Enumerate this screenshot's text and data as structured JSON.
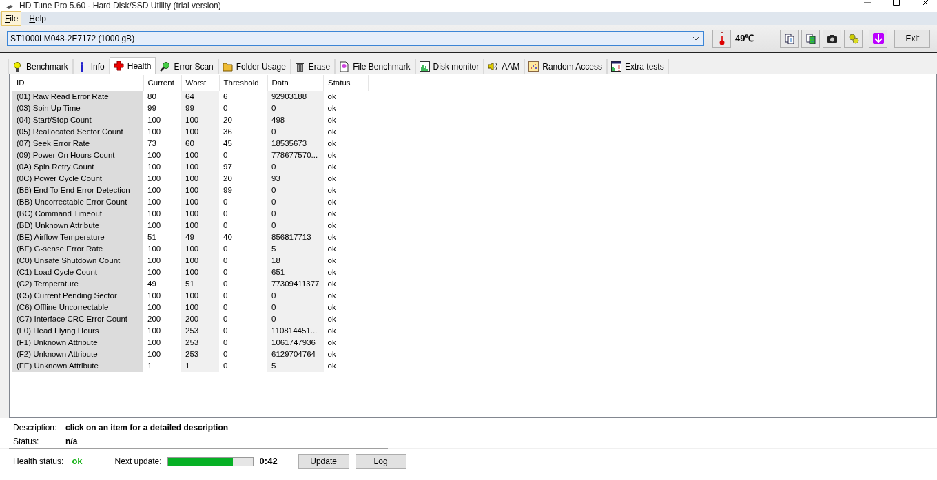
{
  "window": {
    "title": "HD Tune Pro 5.60 - Hard Disk/SSD Utility (trial version)"
  },
  "menu": [
    {
      "label": "File",
      "selected": true
    },
    {
      "label": "Help",
      "selected": false
    }
  ],
  "toolbar": {
    "drive": "ST1000LM048-2E7172 (1000 gB)",
    "temperature": "49℃",
    "tools": [
      {
        "kind": "copy"
      },
      {
        "kind": "copy-all"
      },
      {
        "kind": "camera"
      },
      {
        "kind": "options"
      },
      {
        "kind": "download"
      }
    ],
    "exit": "Exit"
  },
  "tabs": [
    {
      "label": "Benchmark",
      "kind": "bulb",
      "selected": false
    },
    {
      "label": "Info",
      "kind": "info",
      "selected": false
    },
    {
      "label": "Health",
      "kind": "cross",
      "selected": true
    },
    {
      "label": "Error Scan",
      "kind": "magnifier",
      "selected": false
    },
    {
      "label": "Folder Usage",
      "kind": "folder",
      "selected": false
    },
    {
      "label": "Erase",
      "kind": "bin",
      "selected": false
    },
    {
      "label": "File Benchmark",
      "kind": "file",
      "selected": false
    },
    {
      "label": "Disk monitor",
      "kind": "bars",
      "selected": false
    },
    {
      "label": "AAM",
      "kind": "speaker",
      "selected": false
    },
    {
      "label": "Random Access",
      "kind": "dots",
      "selected": false
    },
    {
      "label": "Extra tests",
      "kind": "grid",
      "selected": false
    }
  ],
  "table": {
    "columns": [
      "ID",
      "Current",
      "Worst",
      "Threshold",
      "Data",
      "Status"
    ],
    "rows": [
      [
        "(01) Raw Read Error Rate",
        "80",
        "64",
        "6",
        "92903188",
        "ok"
      ],
      [
        "(03) Spin Up Time",
        "99",
        "99",
        "0",
        "0",
        "ok"
      ],
      [
        "(04) Start/Stop Count",
        "100",
        "100",
        "20",
        "498",
        "ok"
      ],
      [
        "(05) Reallocated Sector Count",
        "100",
        "100",
        "36",
        "0",
        "ok"
      ],
      [
        "(07) Seek Error Rate",
        "73",
        "60",
        "45",
        "18535673",
        "ok"
      ],
      [
        "(09) Power On Hours Count",
        "100",
        "100",
        "0",
        "778677570...",
        "ok"
      ],
      [
        "(0A) Spin Retry Count",
        "100",
        "100",
        "97",
        "0",
        "ok"
      ],
      [
        "(0C) Power Cycle Count",
        "100",
        "100",
        "20",
        "93",
        "ok"
      ],
      [
        "(B8) End To End Error Detection",
        "100",
        "100",
        "99",
        "0",
        "ok"
      ],
      [
        "(BB) Uncorrectable Error Count",
        "100",
        "100",
        "0",
        "0",
        "ok"
      ],
      [
        "(BC) Command Timeout",
        "100",
        "100",
        "0",
        "0",
        "ok"
      ],
      [
        "(BD) Unknown Attribute",
        "100",
        "100",
        "0",
        "0",
        "ok"
      ],
      [
        "(BE) Airflow Temperature",
        "51",
        "49",
        "40",
        "856817713",
        "ok"
      ],
      [
        "(BF) G-sense Error Rate",
        "100",
        "100",
        "0",
        "5",
        "ok"
      ],
      [
        "(C0) Unsafe Shutdown Count",
        "100",
        "100",
        "0",
        "18",
        "ok"
      ],
      [
        "(C1) Load Cycle Count",
        "100",
        "100",
        "0",
        "651",
        "ok"
      ],
      [
        "(C2) Temperature",
        "49",
        "51",
        "0",
        "77309411377",
        "ok"
      ],
      [
        "(C5) Current Pending Sector",
        "100",
        "100",
        "0",
        "0",
        "ok"
      ],
      [
        "(C6) Offline Uncorrectable",
        "100",
        "100",
        "0",
        "0",
        "ok"
      ],
      [
        "(C7) Interface CRC Error Count",
        "200",
        "200",
        "0",
        "0",
        "ok"
      ],
      [
        "(F0) Head Flying Hours",
        "100",
        "253",
        "0",
        "110814451...",
        "ok"
      ],
      [
        "(F1) Unknown Attribute",
        "100",
        "253",
        "0",
        "1061747936",
        "ok"
      ],
      [
        "(F2) Unknown Attribute",
        "100",
        "253",
        "0",
        "6129704764",
        "ok"
      ],
      [
        "(FE) Unknown Attribute",
        "1",
        "1",
        "0",
        "5",
        "ok"
      ]
    ]
  },
  "details": [
    {
      "label": "Description:",
      "value": "click on an item for a detailed description"
    },
    {
      "label": "Status:",
      "value": "n/a"
    }
  ],
  "footer": {
    "health_label": "Health status:",
    "health_value": "ok",
    "next_label": "Next update:",
    "level": 0.77,
    "countdown": "0:42",
    "buttons": [
      "Update",
      "Log"
    ]
  }
}
